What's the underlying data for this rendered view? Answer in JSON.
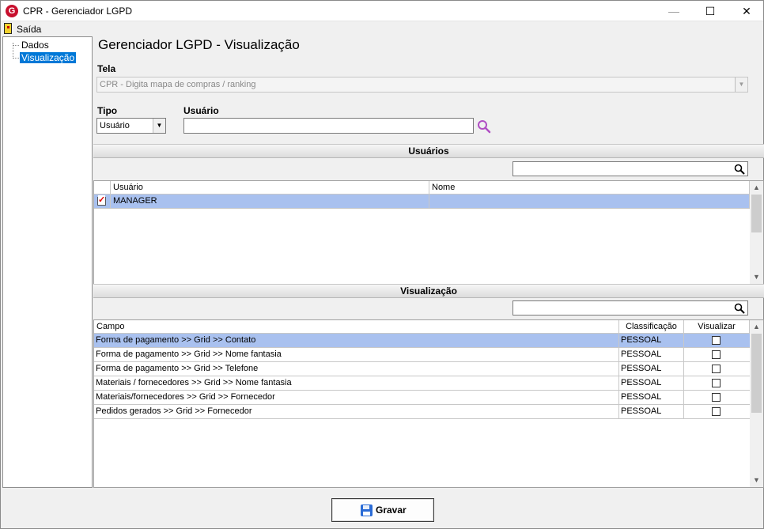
{
  "window": {
    "title": "CPR - Gerenciador LGPD",
    "minimize": "—",
    "maximize": "☐",
    "close": "✕"
  },
  "menu": {
    "exit_label": "Saída"
  },
  "tree": {
    "items": [
      {
        "label": "Dados"
      },
      {
        "label": "Visualização",
        "selected": true
      }
    ]
  },
  "page_title": "Gerenciador LGPD - Visualização",
  "tela": {
    "label": "Tela",
    "value": "CPR - Digita mapa de compras / ranking"
  },
  "tipo": {
    "label": "Tipo",
    "value": "Usuário"
  },
  "usuario": {
    "label": "Usuário",
    "value": ""
  },
  "usuarios_section": {
    "title": "Usuários",
    "search_value": "",
    "columns": [
      "Usuário",
      "Nome"
    ],
    "rows": [
      {
        "checked": true,
        "usuario": "MANAGER",
        "nome": ""
      }
    ]
  },
  "visualizacao_section": {
    "title": "Visualização",
    "search_value": "",
    "columns": [
      "Campo",
      "Classificação",
      "Visualizar"
    ],
    "rows": [
      {
        "campo": "Forma de pagamento >> Grid >> Contato",
        "classificacao": "PESSOAL",
        "visualizar": false
      },
      {
        "campo": "Forma de pagamento >> Grid >> Nome fantasia",
        "classificacao": "PESSOAL",
        "visualizar": false
      },
      {
        "campo": "Forma de pagamento >> Grid >> Telefone",
        "classificacao": "PESSOAL",
        "visualizar": false
      },
      {
        "campo": "Materiais / fornecedores >> Grid >> Nome fantasia",
        "classificacao": "PESSOAL",
        "visualizar": false
      },
      {
        "campo": "Materiais/fornecedores >> Grid >> Fornecedor",
        "classificacao": "PESSOAL",
        "visualizar": false
      },
      {
        "campo": "Pedidos gerados >> Grid >> Fornecedor",
        "classificacao": "PESSOAL",
        "visualizar": false
      }
    ]
  },
  "footer": {
    "save_label": "Gravar"
  },
  "colors": {
    "selection_row": "#a9c1ef",
    "tree_selection": "#0078d7",
    "search_icon": "#b04fc4"
  }
}
